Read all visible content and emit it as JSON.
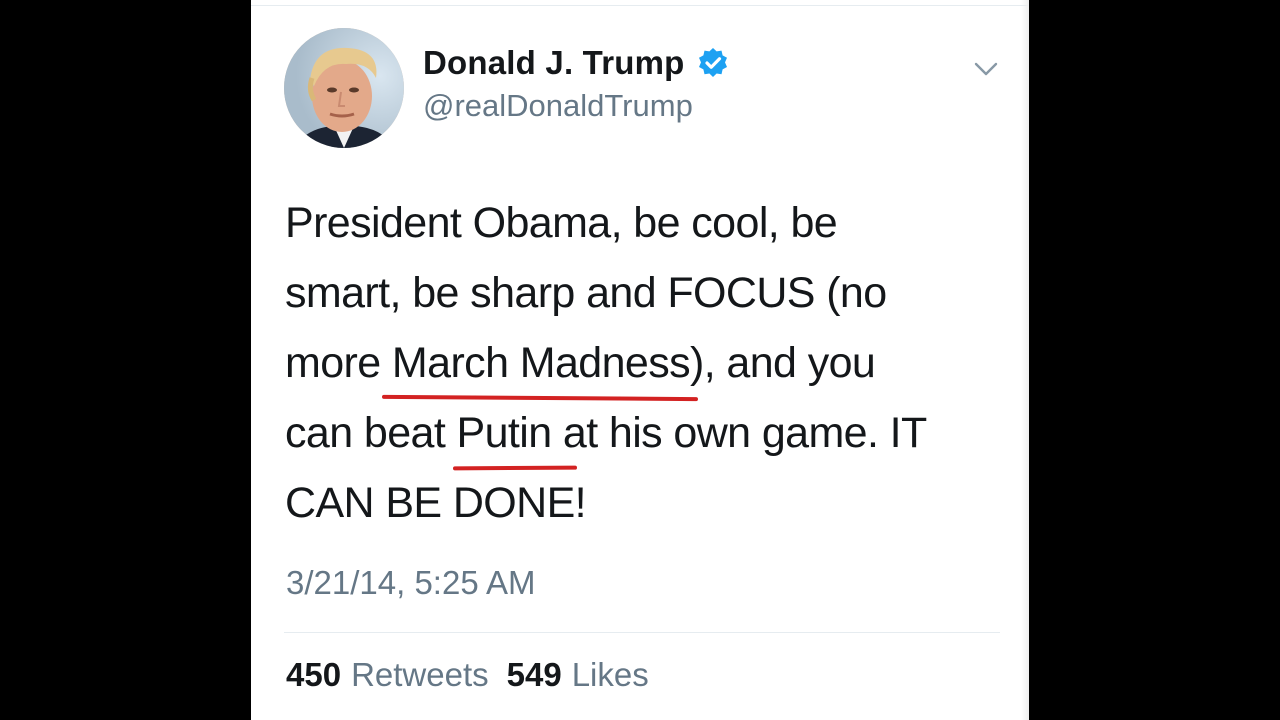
{
  "tweet": {
    "author": {
      "display_name": "Donald J. Trump",
      "handle": "@realDonaldTrump",
      "verified": true,
      "avatar_icon": "profile-photo"
    },
    "text_lines": [
      [
        "President Obama, be cool, be"
      ],
      [
        "smart, be sharp and FOCUS (no"
      ],
      [
        "more ",
        "March Madness",
        "), and you"
      ],
      [
        "can beat ",
        "Putin ",
        "at his own game. IT"
      ],
      [
        "CAN BE DONE!"
      ]
    ],
    "underlined_phrases": [
      "March Madness",
      "Putin"
    ],
    "timestamp": "3/21/14, 5:25 AM",
    "stats": {
      "retweets_count": "450",
      "retweets_label": "Retweets",
      "likes_count": "549",
      "likes_label": "Likes"
    },
    "menu_icon": "chevron-down-icon"
  },
  "colors": {
    "background": "#000000",
    "card": "#ffffff",
    "text": "#14171a",
    "secondary_text": "#657786",
    "verified_blue": "#1da1f2",
    "underline_red": "#d32222"
  }
}
